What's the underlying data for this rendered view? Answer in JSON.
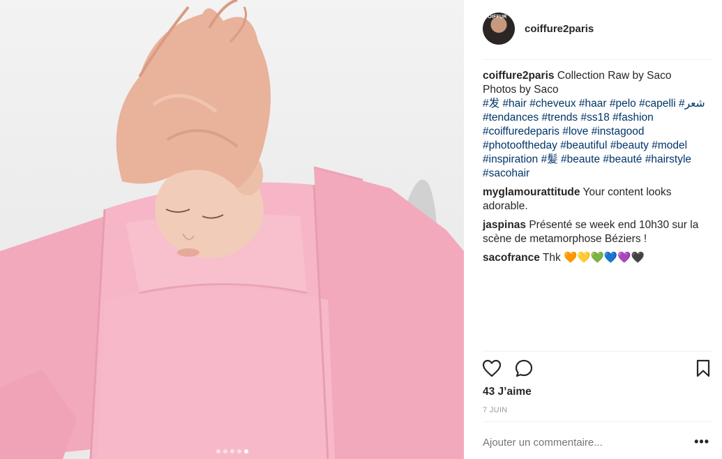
{
  "post": {
    "username": "coiffure2paris",
    "avatar_tag": "COIFFUR",
    "carousel": {
      "count": 5,
      "active_index": 4
    },
    "caption": {
      "user": "coiffure2paris",
      "line1": " Collection Raw by Saco",
      "line2": "Photos by Saco",
      "hashtags": [
        "#发",
        "#hair",
        "#cheveux",
        "#haar",
        "#pelo",
        "#capelli",
        "#شعر",
        "#tendances",
        "#trends",
        "#ss18",
        "#fashion",
        "#coiffuredeparis",
        "#love",
        "#instagood",
        "#photooftheday",
        "#beautiful",
        "#beauty",
        "#model",
        "#inspiration",
        "#髪",
        "#beaute",
        "#beauté",
        "#hairstyle",
        "#sacohair"
      ]
    },
    "comments": [
      {
        "user": "myglamourattitude",
        "text": " Your content looks adorable."
      },
      {
        "user": "jaspinas",
        "text": " Présenté se week end 10h30 sur la scène de metamorphose Béziers !"
      },
      {
        "user": "sacofrance",
        "text": " Thk 🧡💛💚💙💜🖤"
      }
    ],
    "likes": "43 J’aime",
    "date": "7 JUIN",
    "add_comment_placeholder": "Ajouter un commentaire...",
    "more_label": "•••",
    "icons": {
      "like": "heart-outline-icon",
      "comment": "speech-bubble-icon",
      "save": "bookmark-icon"
    },
    "colors": {
      "hashtag": "#003569",
      "text": "#262626",
      "muted": "#999999",
      "garment_pink": "#f5b3c4",
      "hair": "#e9b29a"
    }
  }
}
